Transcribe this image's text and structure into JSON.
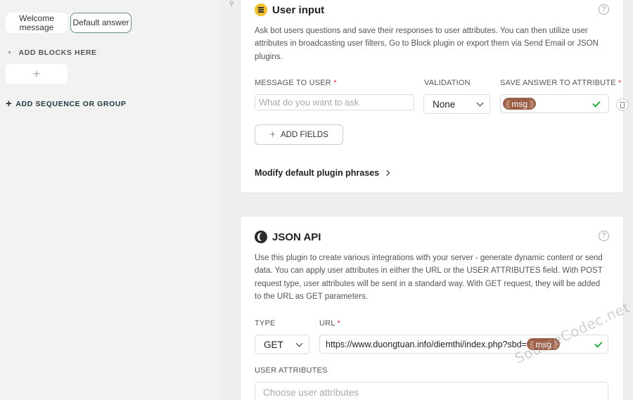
{
  "sidebar": {
    "blocks": [
      {
        "label": "Welcome message"
      },
      {
        "label": "Default answer"
      }
    ],
    "add_blocks_label": "ADD BLOCKS HERE",
    "add_block_plus": "+",
    "add_sequence_label": "ADD SEQUENCE OR GROUP"
  },
  "user_input": {
    "title": "User input",
    "description": "Ask bot users questions and save their responses to user attributes. You can then utilize user attributes in broadcasting user filters, Go to Block plugin or export them via Send Email or JSON plugins.",
    "message_label": "MESSAGE TO USER",
    "message_placeholder": "What do you want to ask",
    "validation_label": "VALIDATION",
    "validation_value": "None",
    "save_label": "SAVE ANSWER TO ATTRIBUTE",
    "attribute_value": "msg",
    "add_fields_label": "ADD FIELDS",
    "modify_label": "Modify default plugin phrases",
    "help": "?"
  },
  "json_api": {
    "title": "JSON API",
    "description": "Use this plugin to create various integrations with your server - generate dynamic content or send data. You can apply user attributes in either the URL or the USER ATTRIBUTES field. With POST request type, user attributes will be sent in a standard way. With GET request, they will be added to the URL as GET parameters.",
    "type_label": "TYPE",
    "type_value": "GET",
    "url_label": "URL",
    "url_value": "https://www.duongtuan.info/diemthi/index.php?sbd=",
    "url_attribute": "msg",
    "user_attributes_label": "USER ATTRIBUTES",
    "user_attributes_placeholder": "Choose user attributes",
    "help": "?"
  },
  "required_mark": "*",
  "watermark": "SourceCodec.net",
  "colors": {
    "attribute_chip": "#9b6048",
    "valid_check": "#2bab4c",
    "required": "#dd3333",
    "user_input_icon": "#f2bf2a"
  }
}
